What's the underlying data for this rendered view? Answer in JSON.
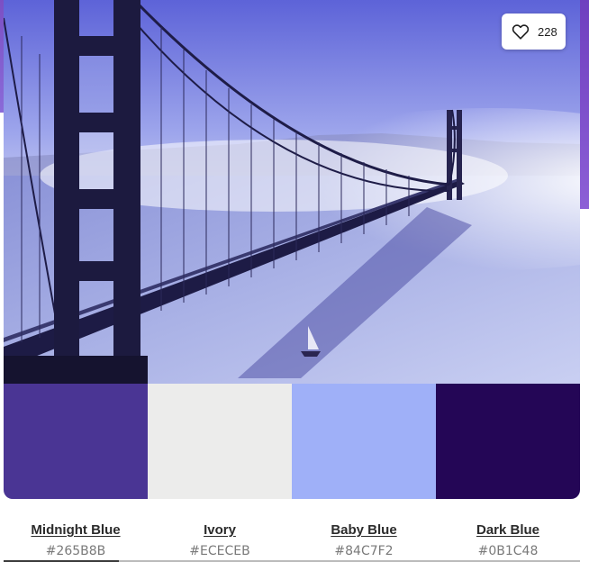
{
  "likes": {
    "count": "228",
    "icon": "heart-outline-icon"
  },
  "palette": [
    {
      "name": "Midnight Blue",
      "hex": "#265B8B",
      "swatch_color": "#4a3594"
    },
    {
      "name": "Ivory",
      "hex": "#ECECEB",
      "swatch_color": "#ececeb"
    },
    {
      "name": "Baby Blue",
      "hex": "#84C7F2",
      "swatch_color": "#9fb0f8"
    },
    {
      "name": "Dark Blue",
      "hex": "#0B1C48",
      "swatch_color": "#240656"
    }
  ]
}
